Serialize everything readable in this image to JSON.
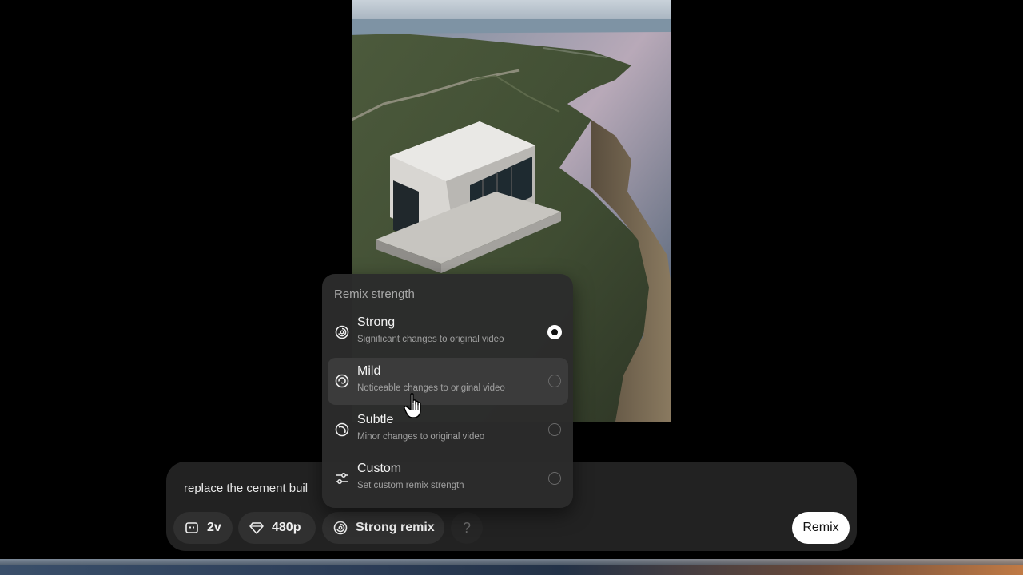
{
  "composer": {
    "prompt_text": "replace the cement buil",
    "variations_label": "2v",
    "resolution_label": "480p",
    "remix_chip_label": "Strong remix",
    "help_label": "?",
    "submit_label": "Remix"
  },
  "popover": {
    "title": "Remix strength",
    "selected": "strong",
    "options": [
      {
        "id": "strong",
        "label": "Strong",
        "description": "Significant changes to original video",
        "icon": "spiral-strong-icon",
        "selected": true
      },
      {
        "id": "mild",
        "label": "Mild",
        "description": "Noticeable changes to original video",
        "icon": "spiral-mild-icon",
        "selected": false
      },
      {
        "id": "subtle",
        "label": "Subtle",
        "description": "Minor changes to original video",
        "icon": "spiral-subtle-icon",
        "selected": false
      },
      {
        "id": "custom",
        "label": "Custom",
        "description": "Set custom remix strength",
        "icon": "sliders-icon",
        "selected": false
      }
    ]
  },
  "colors": {
    "background": "#000000",
    "composer_bg": "#222222",
    "chip_bg": "#303030",
    "popover_bg": "#2c2c2c",
    "accent_white": "#ffffff"
  }
}
